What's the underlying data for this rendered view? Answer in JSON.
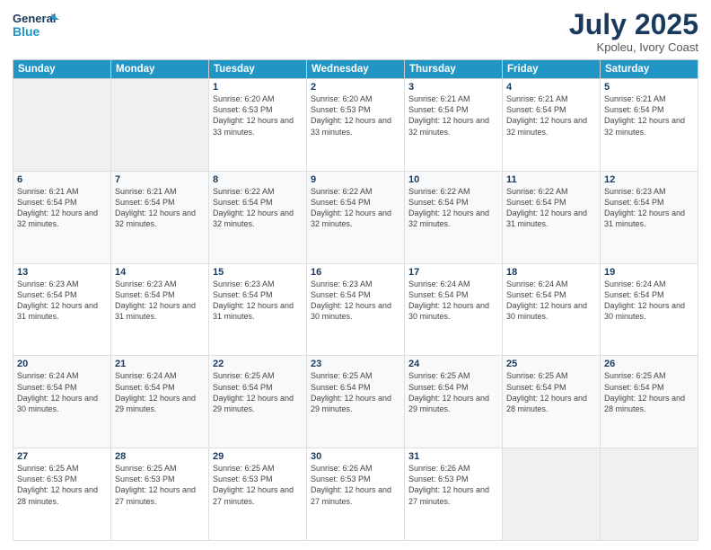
{
  "header": {
    "logo_line1": "General",
    "logo_line2": "Blue",
    "title": "July 2025",
    "subtitle": "Kpoleu, Ivory Coast"
  },
  "columns": [
    "Sunday",
    "Monday",
    "Tuesday",
    "Wednesday",
    "Thursday",
    "Friday",
    "Saturday"
  ],
  "weeks": [
    [
      {
        "day": "",
        "info": ""
      },
      {
        "day": "",
        "info": ""
      },
      {
        "day": "1",
        "info": "Sunrise: 6:20 AM\nSunset: 6:53 PM\nDaylight: 12 hours and 33 minutes."
      },
      {
        "day": "2",
        "info": "Sunrise: 6:20 AM\nSunset: 6:53 PM\nDaylight: 12 hours and 33 minutes."
      },
      {
        "day": "3",
        "info": "Sunrise: 6:21 AM\nSunset: 6:54 PM\nDaylight: 12 hours and 32 minutes."
      },
      {
        "day": "4",
        "info": "Sunrise: 6:21 AM\nSunset: 6:54 PM\nDaylight: 12 hours and 32 minutes."
      },
      {
        "day": "5",
        "info": "Sunrise: 6:21 AM\nSunset: 6:54 PM\nDaylight: 12 hours and 32 minutes."
      }
    ],
    [
      {
        "day": "6",
        "info": "Sunrise: 6:21 AM\nSunset: 6:54 PM\nDaylight: 12 hours and 32 minutes."
      },
      {
        "day": "7",
        "info": "Sunrise: 6:21 AM\nSunset: 6:54 PM\nDaylight: 12 hours and 32 minutes."
      },
      {
        "day": "8",
        "info": "Sunrise: 6:22 AM\nSunset: 6:54 PM\nDaylight: 12 hours and 32 minutes."
      },
      {
        "day": "9",
        "info": "Sunrise: 6:22 AM\nSunset: 6:54 PM\nDaylight: 12 hours and 32 minutes."
      },
      {
        "day": "10",
        "info": "Sunrise: 6:22 AM\nSunset: 6:54 PM\nDaylight: 12 hours and 32 minutes."
      },
      {
        "day": "11",
        "info": "Sunrise: 6:22 AM\nSunset: 6:54 PM\nDaylight: 12 hours and 31 minutes."
      },
      {
        "day": "12",
        "info": "Sunrise: 6:23 AM\nSunset: 6:54 PM\nDaylight: 12 hours and 31 minutes."
      }
    ],
    [
      {
        "day": "13",
        "info": "Sunrise: 6:23 AM\nSunset: 6:54 PM\nDaylight: 12 hours and 31 minutes."
      },
      {
        "day": "14",
        "info": "Sunrise: 6:23 AM\nSunset: 6:54 PM\nDaylight: 12 hours and 31 minutes."
      },
      {
        "day": "15",
        "info": "Sunrise: 6:23 AM\nSunset: 6:54 PM\nDaylight: 12 hours and 31 minutes."
      },
      {
        "day": "16",
        "info": "Sunrise: 6:23 AM\nSunset: 6:54 PM\nDaylight: 12 hours and 30 minutes."
      },
      {
        "day": "17",
        "info": "Sunrise: 6:24 AM\nSunset: 6:54 PM\nDaylight: 12 hours and 30 minutes."
      },
      {
        "day": "18",
        "info": "Sunrise: 6:24 AM\nSunset: 6:54 PM\nDaylight: 12 hours and 30 minutes."
      },
      {
        "day": "19",
        "info": "Sunrise: 6:24 AM\nSunset: 6:54 PM\nDaylight: 12 hours and 30 minutes."
      }
    ],
    [
      {
        "day": "20",
        "info": "Sunrise: 6:24 AM\nSunset: 6:54 PM\nDaylight: 12 hours and 30 minutes."
      },
      {
        "day": "21",
        "info": "Sunrise: 6:24 AM\nSunset: 6:54 PM\nDaylight: 12 hours and 29 minutes."
      },
      {
        "day": "22",
        "info": "Sunrise: 6:25 AM\nSunset: 6:54 PM\nDaylight: 12 hours and 29 minutes."
      },
      {
        "day": "23",
        "info": "Sunrise: 6:25 AM\nSunset: 6:54 PM\nDaylight: 12 hours and 29 minutes."
      },
      {
        "day": "24",
        "info": "Sunrise: 6:25 AM\nSunset: 6:54 PM\nDaylight: 12 hours and 29 minutes."
      },
      {
        "day": "25",
        "info": "Sunrise: 6:25 AM\nSunset: 6:54 PM\nDaylight: 12 hours and 28 minutes."
      },
      {
        "day": "26",
        "info": "Sunrise: 6:25 AM\nSunset: 6:54 PM\nDaylight: 12 hours and 28 minutes."
      }
    ],
    [
      {
        "day": "27",
        "info": "Sunrise: 6:25 AM\nSunset: 6:53 PM\nDaylight: 12 hours and 28 minutes."
      },
      {
        "day": "28",
        "info": "Sunrise: 6:25 AM\nSunset: 6:53 PM\nDaylight: 12 hours and 27 minutes."
      },
      {
        "day": "29",
        "info": "Sunrise: 6:25 AM\nSunset: 6:53 PM\nDaylight: 12 hours and 27 minutes."
      },
      {
        "day": "30",
        "info": "Sunrise: 6:26 AM\nSunset: 6:53 PM\nDaylight: 12 hours and 27 minutes."
      },
      {
        "day": "31",
        "info": "Sunrise: 6:26 AM\nSunset: 6:53 PM\nDaylight: 12 hours and 27 minutes."
      },
      {
        "day": "",
        "info": ""
      },
      {
        "day": "",
        "info": ""
      }
    ]
  ]
}
